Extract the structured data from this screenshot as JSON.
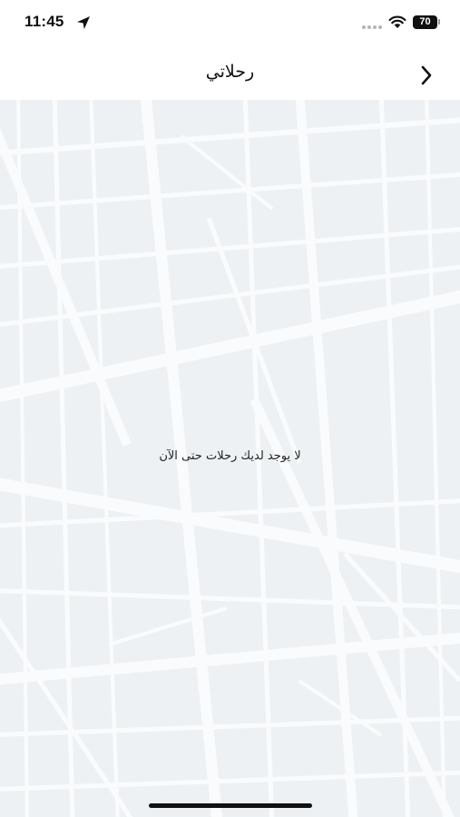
{
  "status_bar": {
    "time": "11:45",
    "battery_level": "70"
  },
  "nav": {
    "title": "رحلاتي"
  },
  "main": {
    "empty_message": "لا يوجد لديك رحلات حتى الآن"
  },
  "colors": {
    "map_background": "#eef1f4",
    "map_roads": "#fafbfc",
    "text": "#111111"
  }
}
